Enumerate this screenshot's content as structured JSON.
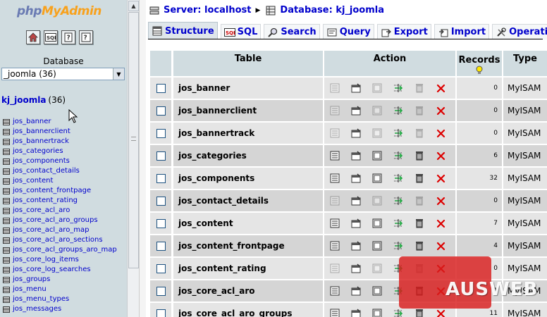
{
  "left": {
    "logo": {
      "php": "php",
      "admin": "MyAdmin"
    },
    "nav_icons": [
      "home-icon",
      "sql-query-icon",
      "documentation-icon",
      "sql-docs-icon"
    ],
    "database_label": "Database",
    "database_select_value": "_joomla (36)",
    "db_heading": {
      "name": "kj_joomla",
      "count": "(36)"
    },
    "tables": [
      "jos_banner",
      "jos_bannerclient",
      "jos_bannertrack",
      "jos_categories",
      "jos_components",
      "jos_contact_details",
      "jos_content",
      "jos_content_frontpage",
      "jos_content_rating",
      "jos_core_acl_aro",
      "jos_core_acl_aro_groups",
      "jos_core_acl_aro_map",
      "jos_core_acl_aro_sections",
      "jos_core_acl_groups_aro_map",
      "jos_core_log_items",
      "jos_core_log_searches",
      "jos_groups",
      "jos_menu",
      "jos_menu_types",
      "jos_messages"
    ]
  },
  "breadcrumb": {
    "server": "Server: localhost",
    "database": "Database: kj_joomla"
  },
  "tabs": [
    "Structure",
    "SQL",
    "Search",
    "Query",
    "Export",
    "Import",
    "Operations"
  ],
  "table": {
    "headers": {
      "table": "Table",
      "action": "Action",
      "records": "Records",
      "type": "Type"
    },
    "rows": [
      {
        "name": "jos_banner",
        "records": "0",
        "type": "MyISAM",
        "has_data": false
      },
      {
        "name": "jos_bannerclient",
        "records": "0",
        "type": "MyISAM",
        "has_data": false
      },
      {
        "name": "jos_bannertrack",
        "records": "0",
        "type": "MyISAM",
        "has_data": false
      },
      {
        "name": "jos_categories",
        "records": "6",
        "type": "MyISAM",
        "has_data": true
      },
      {
        "name": "jos_components",
        "records": "32",
        "type": "MyISAM",
        "has_data": true
      },
      {
        "name": "jos_contact_details",
        "records": "0",
        "type": "MyISAM",
        "has_data": false
      },
      {
        "name": "jos_content",
        "records": "7",
        "type": "MyISAM",
        "has_data": true
      },
      {
        "name": "jos_content_frontpage",
        "records": "4",
        "type": "MyISAM",
        "has_data": true
      },
      {
        "name": "jos_content_rating",
        "records": "0",
        "type": "MyISAM",
        "has_data": false
      },
      {
        "name": "jos_core_acl_aro",
        "records": "1",
        "type": "MyISAM",
        "has_data": true
      },
      {
        "name": "jos_core_acl_aro_groups",
        "records": "11",
        "type": "MyISAM",
        "has_data": true
      }
    ]
  },
  "watermark": "AUSWEB",
  "colors": {
    "sidebar_bg": "#d0dce0",
    "header_bg": "#d0dce0",
    "row_odd": "#e5e5e5",
    "row_even": "#d5d5d5",
    "link": "#0000cc",
    "drop": "#dd0000",
    "watermark": "#d81c1c"
  }
}
